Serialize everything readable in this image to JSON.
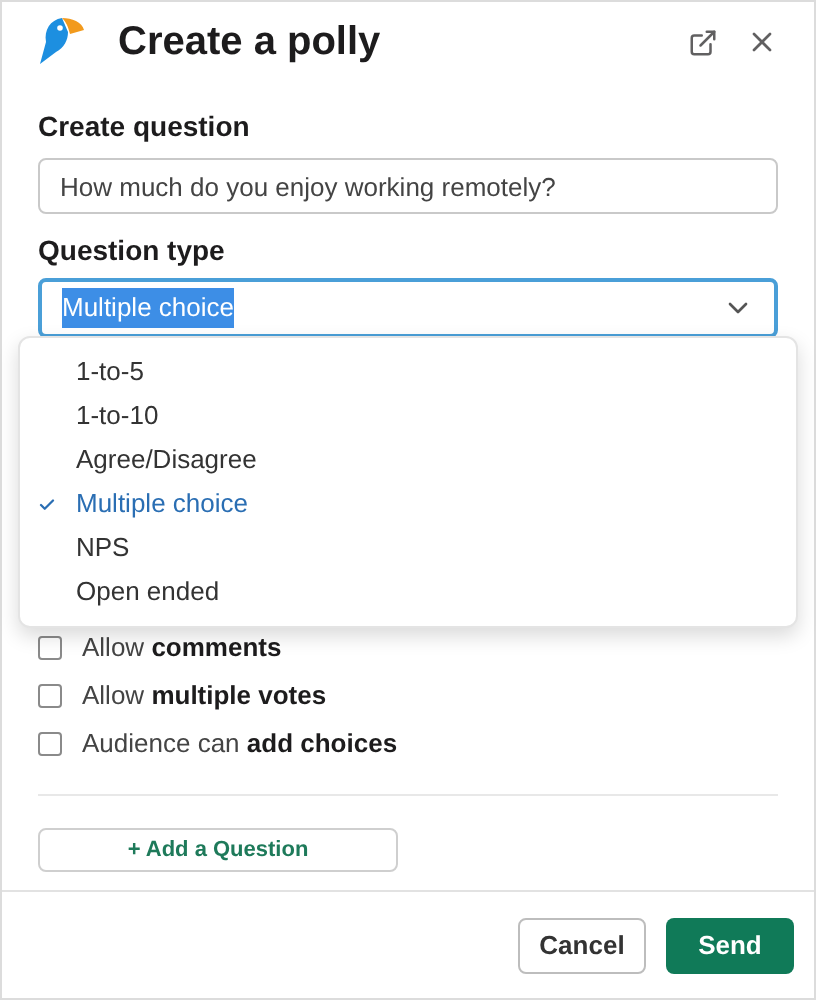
{
  "header": {
    "title": "Create a polly"
  },
  "question": {
    "label": "Create question",
    "value": "How much do you enjoy working remotely?"
  },
  "question_type": {
    "label": "Question type",
    "value": "Multiple choice",
    "expanded": true,
    "options": [
      {
        "label": "1-to-5",
        "selected": false
      },
      {
        "label": "1-to-10",
        "selected": false
      },
      {
        "label": "Agree/Disagree",
        "selected": false
      },
      {
        "label": "Multiple choice",
        "selected": true
      },
      {
        "label": "NPS",
        "selected": false
      },
      {
        "label": "Open ended",
        "selected": false
      }
    ]
  },
  "settings": [
    {
      "label": "Allow **comments**",
      "checked": false
    },
    {
      "label": "Allow **multiple votes**",
      "checked": false
    },
    {
      "label": "Audience can **add choices**",
      "checked": false
    }
  ],
  "add_question": "+ Add a Question",
  "buttons": {
    "cancel": "Cancel",
    "send": "Send"
  }
}
